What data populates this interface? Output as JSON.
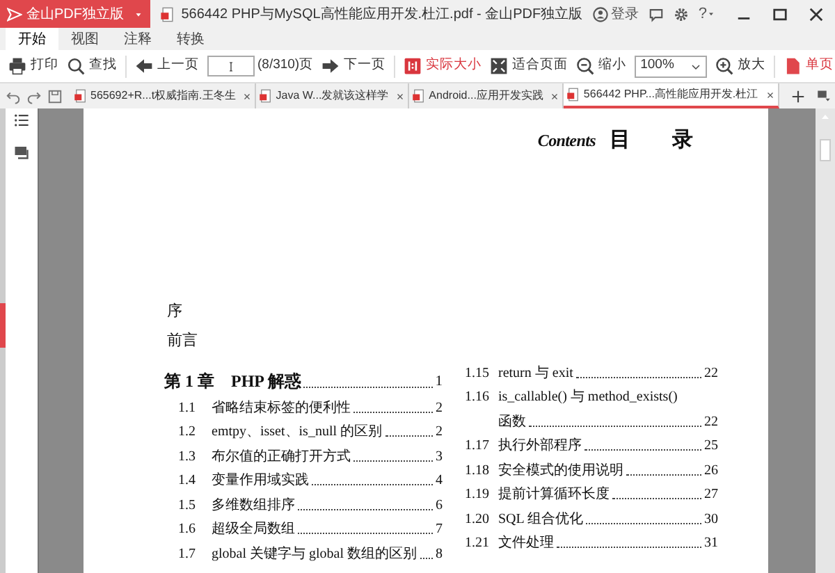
{
  "app_button": {
    "label": "金山PDF独立版"
  },
  "window": {
    "title": "566442 PHP与MySQL高性能应用开发.杜江.pdf - 金山PDF独立版",
    "login": "登录",
    "help": "?"
  },
  "menu_tabs": [
    {
      "label": "开始",
      "selected": true
    },
    {
      "label": "视图",
      "selected": false
    },
    {
      "label": "注释",
      "selected": false
    },
    {
      "label": "转换",
      "selected": false
    }
  ],
  "toolbar": {
    "print": "打印",
    "find": "查找",
    "prev": "上一页",
    "page_count": "(8/310)页",
    "next": "下一页",
    "actual_size": "实际大小",
    "fit_page": "适合页面",
    "zoom_out": "缩小",
    "zoom_value": "100%",
    "zoom_in": "放大",
    "single_page": "单页"
  },
  "doc_tabs": [
    {
      "label": "565692+R...t权威指南.王冬生",
      "selected": false
    },
    {
      "label": "Java W...发就该这样学",
      "selected": false
    },
    {
      "label": "Android...应用开发实践",
      "selected": false
    },
    {
      "label": "566442 PHP...高性能应用开发.杜江",
      "selected": true
    }
  ],
  "page": {
    "heading_script": "Contents",
    "heading": "目　　录",
    "front_matter": [
      "序",
      "前言"
    ],
    "chapter": {
      "label": "第 1 章　PHP 解惑",
      "page": "1"
    },
    "left_entries": [
      {
        "number": "1.1",
        "title": "省略结束标签的便利性",
        "page": "2"
      },
      {
        "number": "1.2",
        "title": "emtpy、isset、is_null 的区别",
        "page": "2"
      },
      {
        "number": "1.3",
        "title": "布尔值的正确打开方式",
        "page": "3"
      },
      {
        "number": "1.4",
        "title": "变量作用域实践",
        "page": "4"
      },
      {
        "number": "1.5",
        "title": "多维数组排序",
        "page": "6"
      },
      {
        "number": "1.6",
        "title": "超级全局数组",
        "page": "7"
      },
      {
        "number": "1.7",
        "title": "global 关键字与 global 数组的区别",
        "page": "8"
      }
    ],
    "right_entries": [
      {
        "number": "1.15",
        "title": "return 与 exit",
        "page": "22"
      },
      {
        "number": "1.16",
        "title": "is_callable() 与 method_exists()",
        "continuation": "函数",
        "page": "22"
      },
      {
        "number": "1.17",
        "title": "执行外部程序",
        "page": "25"
      },
      {
        "number": "1.18",
        "title": "安全模式的使用说明",
        "page": "26"
      },
      {
        "number": "1.19",
        "title": "提前计算循环长度",
        "page": "27"
      },
      {
        "number": "1.20",
        "title": "SQL 组合优化",
        "page": "30"
      },
      {
        "number": "1.21",
        "title": "文件处理",
        "page": "31"
      }
    ]
  }
}
